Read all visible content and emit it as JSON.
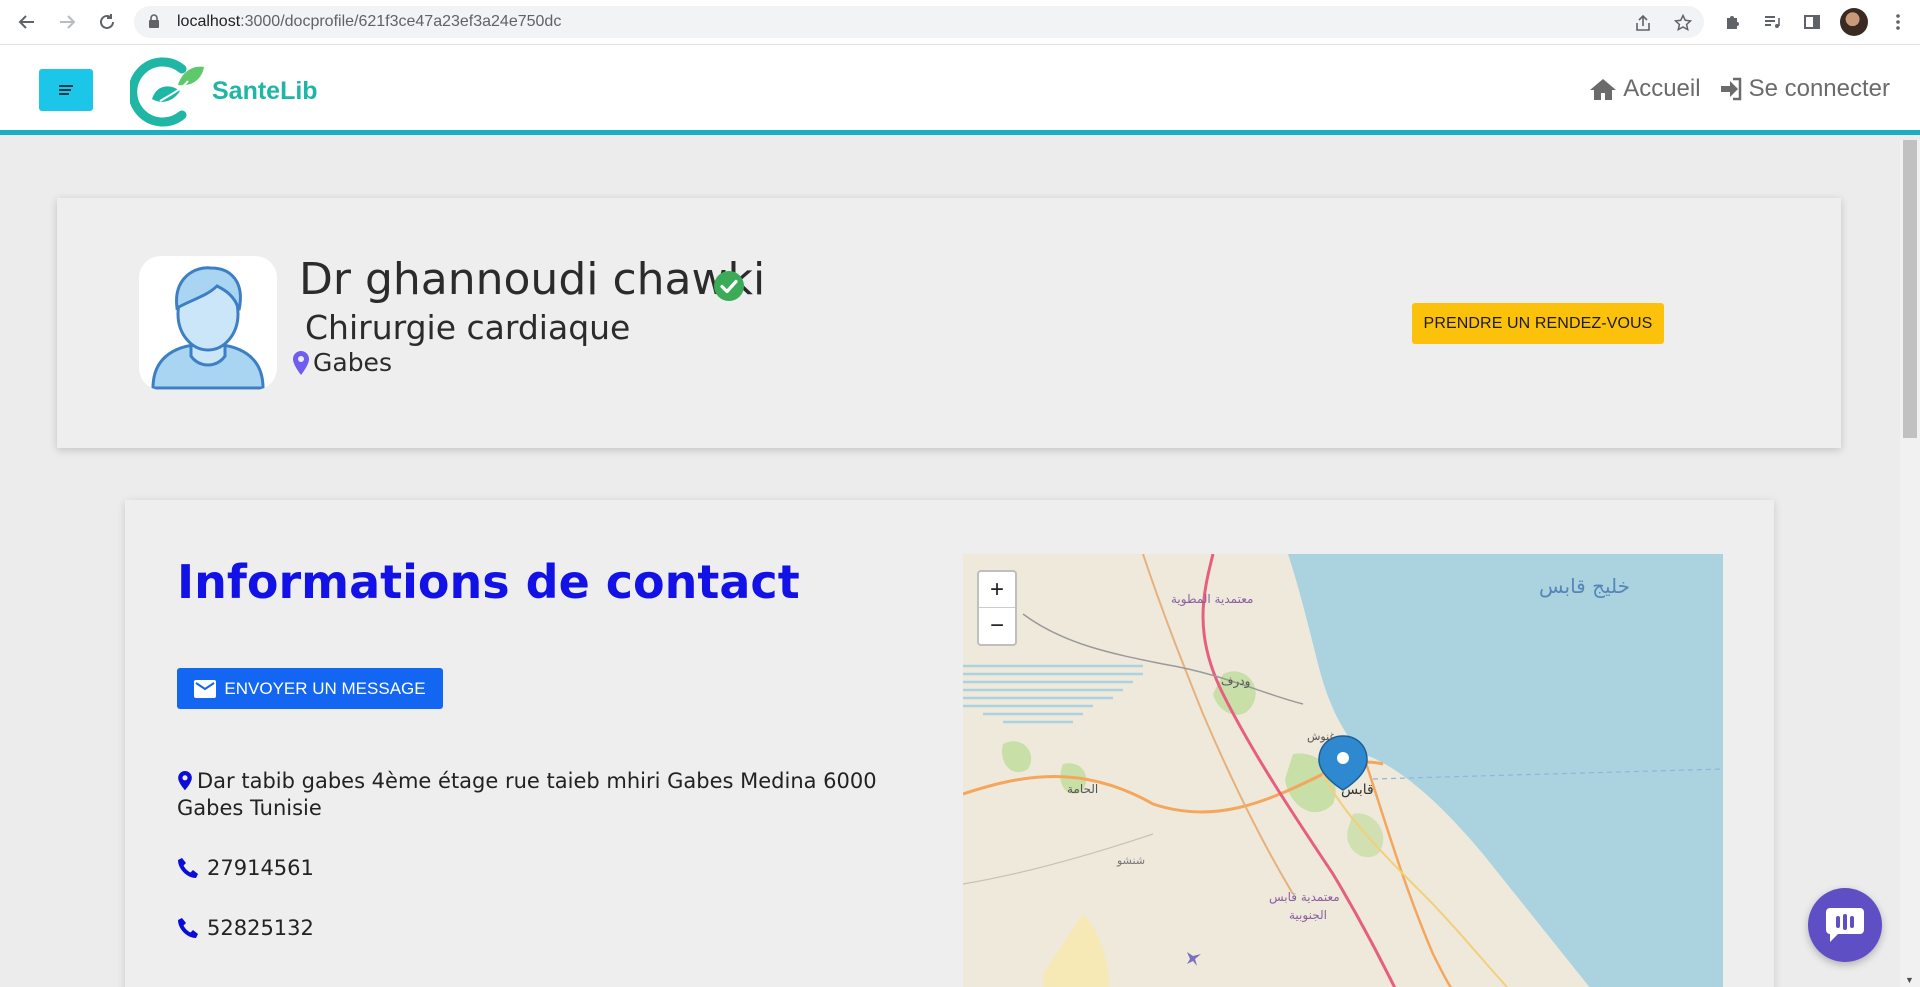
{
  "browser": {
    "url_host": "localhost",
    "url_path": ":3000/docprofile/621f3ce47a23ef3a24e750dc"
  },
  "header": {
    "logo_text": "SanteLib",
    "nav": [
      {
        "label": "Accueil",
        "icon": "home-icon"
      },
      {
        "label": "Se connecter",
        "icon": "sign-in-icon"
      }
    ]
  },
  "profile": {
    "name": "Dr ghannoudi chawki",
    "verified": true,
    "specialty": "Chirurgie cardiaque",
    "city": "Gabes",
    "appointment_button": "PRENDRE UN RENDEZ-VOUS"
  },
  "contact": {
    "title": "Informations de contact",
    "message_button": "ENVOYER UN MESSAGE",
    "address": "Dar tabib gabes 4ème étage rue taieb mhiri Gabes Medina 6000 Gabes Tunisie",
    "phones": [
      "27914561",
      "52825132"
    ]
  },
  "map": {
    "zoom_in": "+",
    "zoom_out": "−",
    "labels": {
      "gulf": "خليج قابس",
      "matmata": "معتمدية المطوية",
      "ouedref": "ودرف",
      "ghannouch": "غنوش",
      "gabes": "قابس",
      "hamma": "الحامة",
      "chenini": "شنشو",
      "gabes_south": "معتمدية قابس",
      "gabes_south2": "الجنوبية"
    }
  },
  "colors": {
    "accent": "#1ab0c4",
    "brand_green": "#1fb6a6",
    "appointment": "#fcc10a",
    "primary": "#1266f1",
    "title_blue": "#1212e6",
    "chat": "#5e4fc4"
  }
}
